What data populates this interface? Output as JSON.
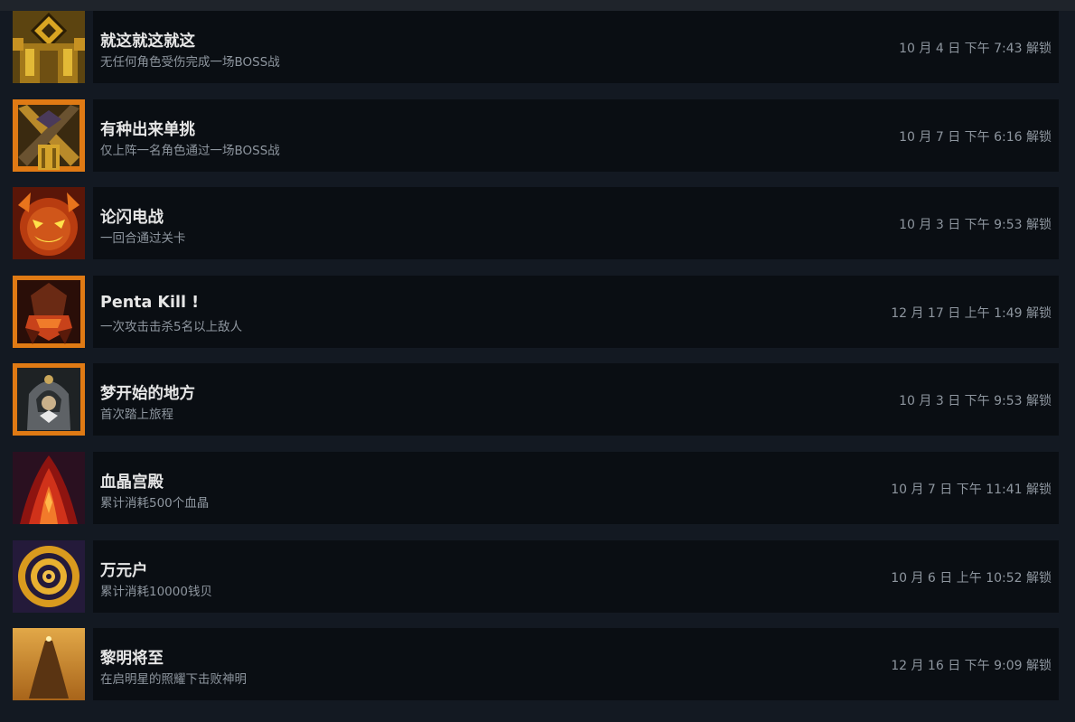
{
  "achievements": [
    {
      "title": "就这就这就这",
      "desc": "无任何角色受伤完成一场BOSS战",
      "unlock_time": "10 月 4 日 下午 7:43 解锁",
      "icon": "golden-armor-icon"
    },
    {
      "title": "有种出来单挑",
      "desc": "仅上阵一名角色通过一场BOSS战",
      "unlock_time": "10 月 7 日 下午 6:16 解锁",
      "icon": "crossed-blades-icon"
    },
    {
      "title": "论闪电战",
      "desc": "一回合通过关卡",
      "unlock_time": "10 月 3 日 下午 9:53 解锁",
      "icon": "fire-demon-face-icon"
    },
    {
      "title": "Penta Kill !",
      "desc": "一次攻击击杀5名以上敌人",
      "unlock_time": "12 月 17 日 上午 1:49 解锁",
      "icon": "crimson-claw-icon"
    },
    {
      "title": "梦开始的地方",
      "desc": "首次踏上旅程",
      "unlock_time": "10 月 3 日 下午 9:53 解锁",
      "icon": "hooded-figure-icon"
    },
    {
      "title": "血晶宫殿",
      "desc": "累计消耗500个血晶",
      "unlock_time": "10 月 7 日 下午 11:41 解锁",
      "icon": "blood-crystal-icon"
    },
    {
      "title": "万元户",
      "desc": "累计消耗10000钱贝",
      "unlock_time": "10 月 6 日 上午 10:52 解锁",
      "icon": "golden-spiral-icon"
    },
    {
      "title": "黎明将至",
      "desc": "在启明星的照耀下击败神明",
      "unlock_time": "12 月 16 日 下午 9:09 解锁",
      "icon": "dawn-silhouette-icon"
    }
  ]
}
